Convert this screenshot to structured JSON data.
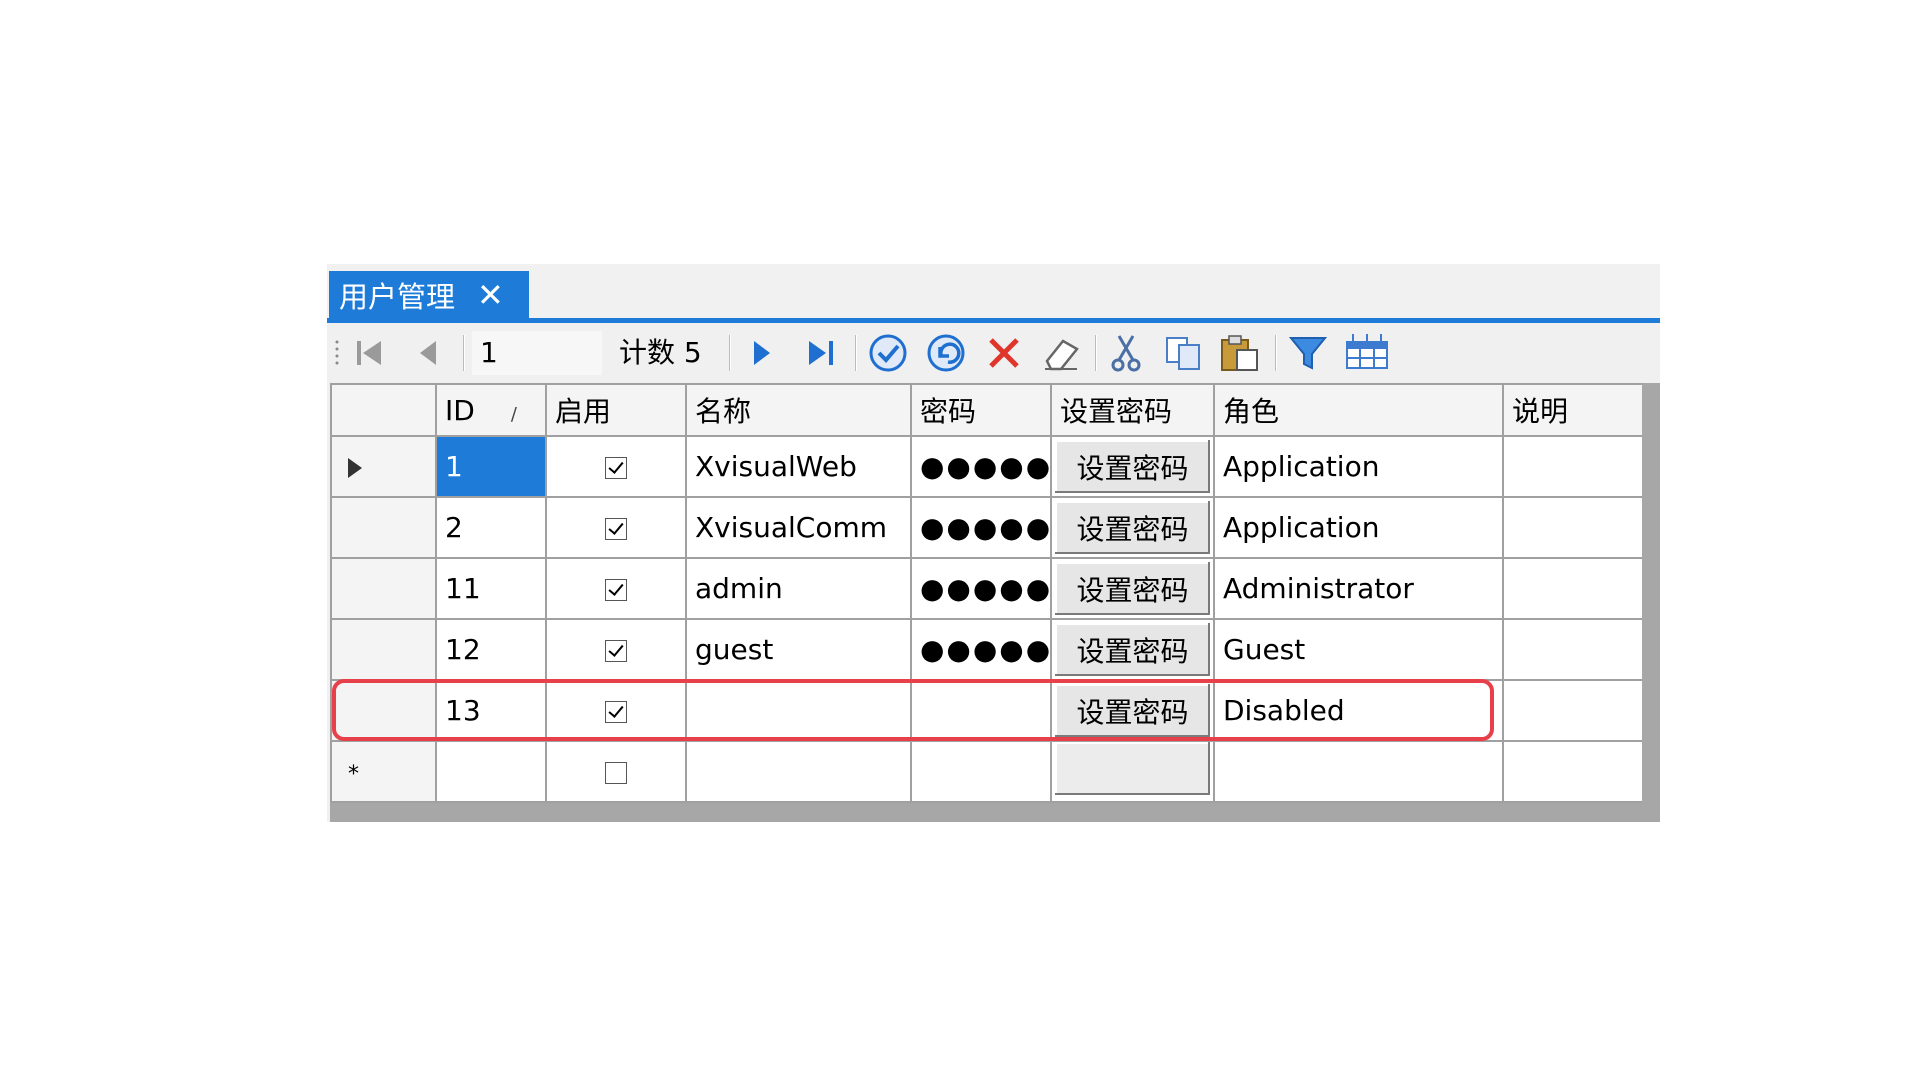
{
  "tab": {
    "title": "用户管理",
    "close_symbol": "✕"
  },
  "toolbar": {
    "position_value": "1",
    "count_label": "计数 5",
    "icons": [
      "first-icon",
      "prev-icon",
      "next-icon",
      "last-icon",
      "confirm-icon",
      "undo-icon",
      "delete-icon",
      "eraser-icon",
      "cut-icon",
      "copy-icon",
      "paste-icon",
      "filter-icon",
      "columns-icon"
    ]
  },
  "grid": {
    "columns": [
      "ID",
      "启用",
      "名称",
      "密码",
      "设置密码",
      "角色",
      "说明"
    ],
    "sort_indicator": "/",
    "password_mask": "●●●●●",
    "rows": [
      {
        "id": "1",
        "enabled": true,
        "name": "XvisualWeb",
        "password": "●●●●●",
        "action": "设置密码",
        "role": "Application",
        "note": ""
      },
      {
        "id": "2",
        "enabled": true,
        "name": "XvisualComm",
        "password": "●●●●●",
        "action": "设置密码",
        "role": "Application",
        "note": ""
      },
      {
        "id": "11",
        "enabled": true,
        "name": "admin",
        "password": "●●●●●",
        "action": "设置密码",
        "role": "Administrator",
        "note": ""
      },
      {
        "id": "12",
        "enabled": true,
        "name": "guest",
        "password": "●●●●●",
        "action": "设置密码",
        "role": "Guest",
        "note": ""
      },
      {
        "id": "13",
        "enabled": true,
        "name": "",
        "password": "",
        "action": "设置密码",
        "role": "Disabled",
        "note": ""
      }
    ],
    "new_row_marker": "*"
  },
  "colors": {
    "accent": "#1e7cd8",
    "highlight": "#e8404a"
  }
}
